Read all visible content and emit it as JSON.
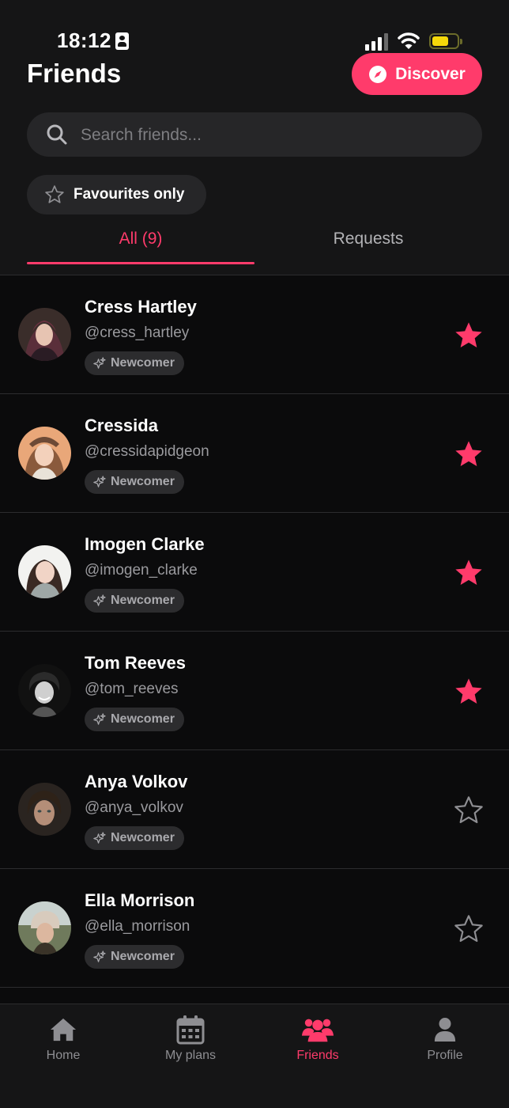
{
  "status_bar": {
    "time": "18:12"
  },
  "header": {
    "title": "Friends",
    "discover_label": "Discover"
  },
  "search": {
    "placeholder": "Search friends..."
  },
  "filter": {
    "favourites_label": "Favourites only"
  },
  "tabs": [
    {
      "label": "All (9)",
      "active": true
    },
    {
      "label": "Requests",
      "active": false
    }
  ],
  "friends": [
    {
      "name": "Cress Hartley",
      "handle": "@cress_hartley",
      "badge": "Newcomer",
      "favourite": true
    },
    {
      "name": "Cressida",
      "handle": "@cressidapidgeon",
      "badge": "Newcomer",
      "favourite": true
    },
    {
      "name": "Imogen Clarke",
      "handle": "@imogen_clarke",
      "badge": "Newcomer",
      "favourite": true
    },
    {
      "name": "Tom Reeves",
      "handle": "@tom_reeves",
      "badge": "Newcomer",
      "favourite": true
    },
    {
      "name": "Anya Volkov",
      "handle": "@anya_volkov",
      "badge": "Newcomer",
      "favourite": false
    },
    {
      "name": "Ella Morrison",
      "handle": "@ella_morrison",
      "badge": "Newcomer",
      "favourite": false
    }
  ],
  "bottom_nav": [
    {
      "label": "Home",
      "icon": "home-icon",
      "active": false
    },
    {
      "label": "My plans",
      "icon": "calendar-icon",
      "active": false
    },
    {
      "label": "Friends",
      "icon": "users-icon",
      "active": true
    },
    {
      "label": "Profile",
      "icon": "user-icon",
      "active": false
    }
  ],
  "colors": {
    "accent": "#ff3b6b",
    "background": "#0b0b0c",
    "header_background": "#151516",
    "surface": "#262628",
    "muted_text": "#9a9a9e"
  }
}
